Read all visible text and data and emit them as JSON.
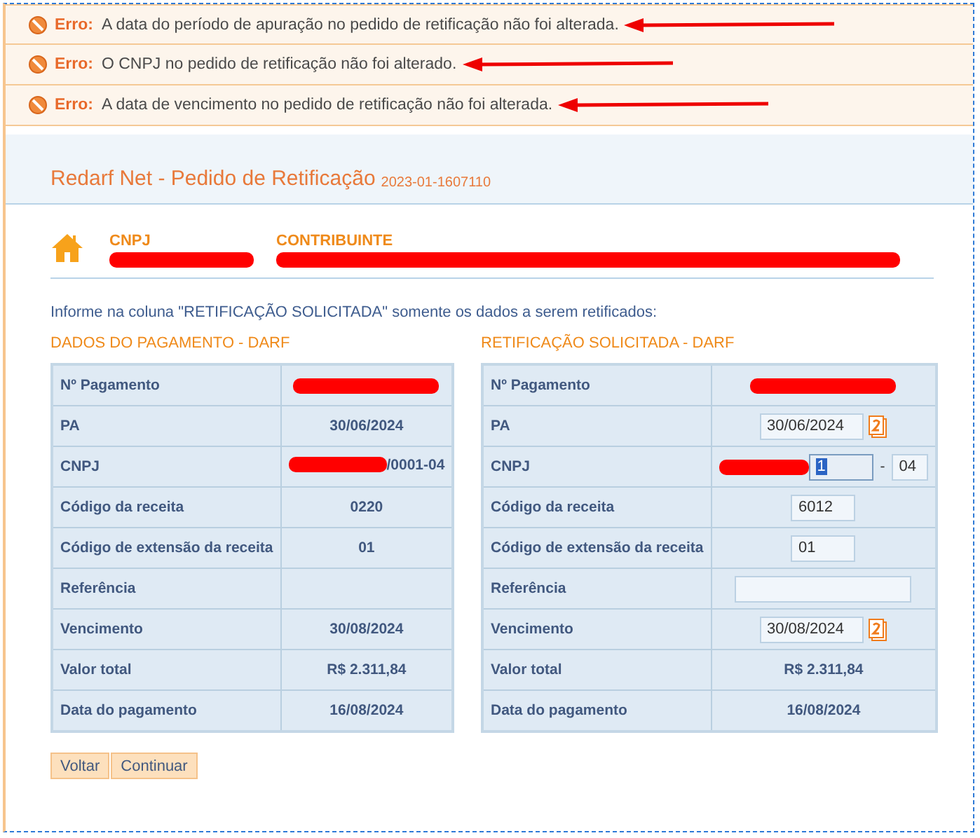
{
  "errors": [
    {
      "label": "Erro:",
      "message": "A data do período de apuração no pedido de retificação não foi alterada.",
      "arrow": true
    },
    {
      "label": "Erro:",
      "message": "O CNPJ no pedido de retificação não foi alterado.",
      "arrow": true
    },
    {
      "label": "Erro:",
      "message": "A data de vencimento no pedido de retificação não foi alterada.",
      "arrow": true
    }
  ],
  "header": {
    "title": "Redarf Net - Pedido de Retificação",
    "code": "2023-01-1607110"
  },
  "taxpayer": {
    "cnpj_label": "CNPJ",
    "cnpj_redacted": true,
    "name_label": "CONTRIBUINTE",
    "name_redacted": true
  },
  "instruction": "Informe na coluna \"RETIFICAÇÃO SOLICITADA\" somente os dados a serem retificados:",
  "left_table": {
    "title": "DADOS DO PAGAMENTO - DARF",
    "rows": [
      {
        "label": "Nº Pagamento",
        "kind": "redacted"
      },
      {
        "label": "PA",
        "kind": "text",
        "value": "30/06/2024"
      },
      {
        "label": "CNPJ",
        "kind": "redacted_text",
        "value": "/0001-04"
      },
      {
        "label": "Código da receita",
        "kind": "text",
        "value": "0220"
      },
      {
        "label": "Código de extensão da receita",
        "kind": "text",
        "value": "01"
      },
      {
        "label": "Referência",
        "kind": "empty"
      },
      {
        "label": "Vencimento",
        "kind": "text",
        "value": "30/08/2024"
      },
      {
        "label": "Valor total",
        "kind": "text",
        "value": "R$ 2.311,84"
      },
      {
        "label": "Data do pagamento",
        "kind": "text",
        "value": "16/08/2024"
      }
    ]
  },
  "right_table": {
    "title": "RETIFICAÇÃO SOLICITADA - DARF",
    "rows": [
      {
        "label": "Nº Pagamento",
        "kind": "redacted"
      },
      {
        "label": "PA",
        "kind": "date_field",
        "value": "30/06/2024"
      },
      {
        "label": "CNPJ",
        "kind": "cnpj_fields",
        "value": "1",
        "separator": "-",
        "suffix": "04"
      },
      {
        "label": "Código da receita",
        "kind": "field",
        "value": "6012"
      },
      {
        "label": "Código de extensão da receita",
        "kind": "field",
        "value": "01"
      },
      {
        "label": "Referência",
        "kind": "wide_field"
      },
      {
        "label": "Vencimento",
        "kind": "date_field",
        "value": "30/08/2024"
      },
      {
        "label": "Valor total",
        "kind": "text",
        "value": "R$ 2.311,84"
      },
      {
        "label": "Data do pagamento",
        "kind": "text",
        "value": "16/08/2024"
      }
    ]
  },
  "buttons": [
    "Voltar",
    "Continuar"
  ]
}
